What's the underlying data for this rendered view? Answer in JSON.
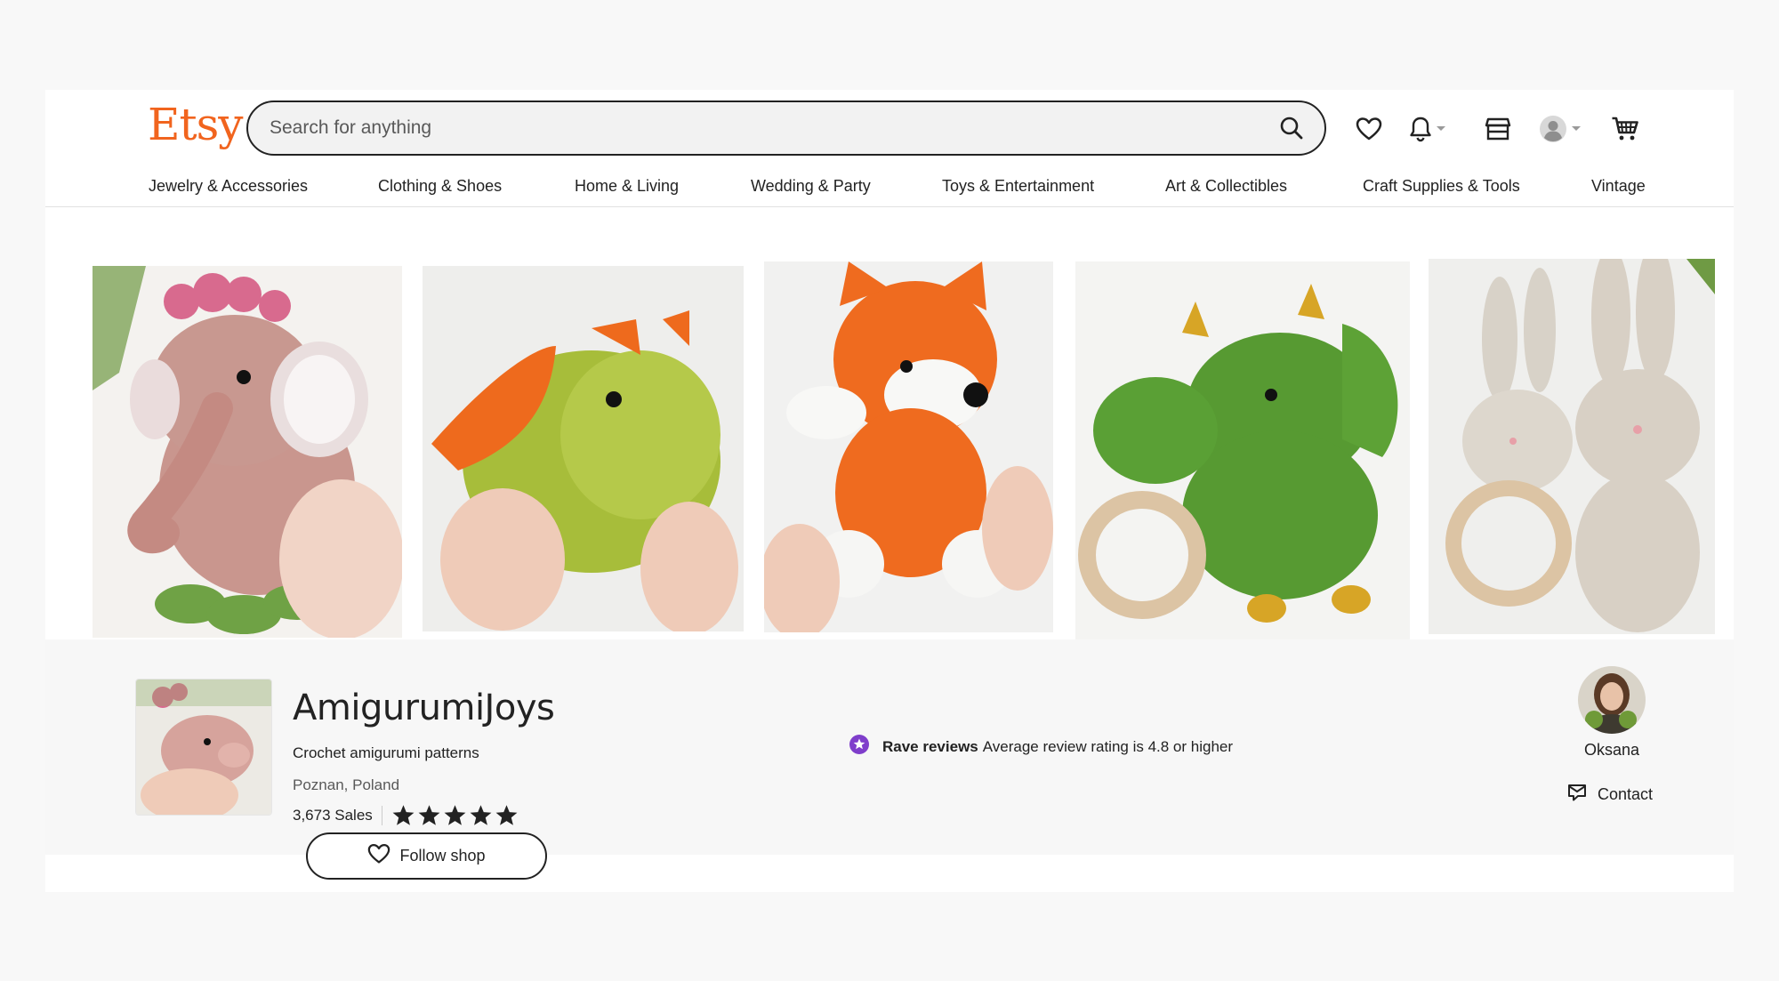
{
  "header": {
    "logo": "Etsy",
    "search_placeholder": "Search for anything"
  },
  "nav": {
    "items": [
      "Jewelry & Accessories",
      "Clothing & Shoes",
      "Home & Living",
      "Wedding & Party",
      "Toys & Entertainment",
      "Art & Collectibles",
      "Craft Supplies & Tools",
      "Vintage"
    ]
  },
  "banner": {
    "images": [
      "crochet-elephant",
      "crochet-dragon",
      "crochet-fox",
      "crochet-dinosaurs",
      "crochet-bunnies"
    ]
  },
  "shop": {
    "name": "AmigurumiJoys",
    "tagline": "Crochet amigurumi patterns",
    "location": "Poznan, Poland",
    "sales": "3,673 Sales",
    "rating_stars": 5,
    "follow_label": "Follow shop"
  },
  "badge": {
    "title": "Rave reviews",
    "description": "Average review rating is 4.8 or higher"
  },
  "owner": {
    "name": "Oksana",
    "contact_label": "Contact"
  },
  "colors": {
    "brand": "#f1641e",
    "badge": "#7f3ecb",
    "text": "#222222"
  }
}
